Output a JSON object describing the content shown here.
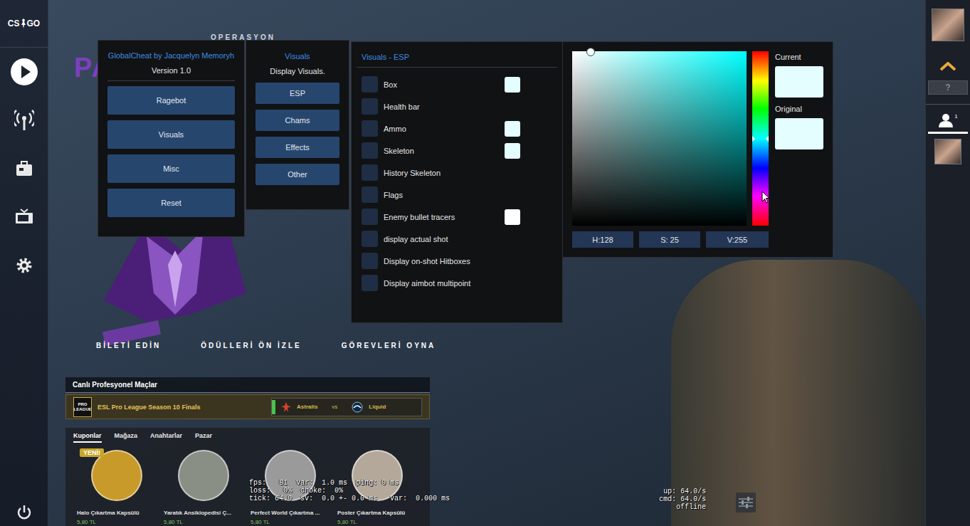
{
  "game": {
    "logo": {
      "left": "CS",
      "right": "GO"
    },
    "operation": {
      "title": "OPERASYON",
      "logo_text": "PA"
    },
    "promo_links": [
      "BİLETİ EDİN",
      "ÖDÜLLERİ ÖN İZLE",
      "GÖREVLERİ OYNA"
    ],
    "live_matches": {
      "title": "Canlı Profesyonel Maçlar",
      "league_logo": [
        "PRO",
        "LEAGUE"
      ],
      "event": "ESL Pro League Season 10 Finals",
      "team1": "Astralis",
      "vs": "vs",
      "team2": "Liquid",
      "live": true
    },
    "store": {
      "tabs": [
        {
          "label": "Kuponlar",
          "selected": true
        },
        {
          "label": "Mağaza",
          "selected": false
        },
        {
          "label": "Anahtarlar",
          "selected": false
        },
        {
          "label": "Pazar",
          "selected": false
        }
      ],
      "items": [
        {
          "name": "Halo Çıkartma Kapsülü",
          "price": "5,80 TL",
          "badge": "YENİ!",
          "color": "#c89a2a"
        },
        {
          "name": "Yaratık Ansiklopedisi Ç...",
          "price": "5,80 TL",
          "color": "#8a8f86"
        },
        {
          "name": "Perfect World Çıkartma ...",
          "price": "5,80 TL",
          "color": "#9a9a9a"
        },
        {
          "name": "Poster Çıkartma Kapsülü",
          "price": "5,80 TL",
          "color": "#b3a89a"
        }
      ]
    },
    "net_graph": {
      "lines": [
        "fps:   81  var:  1.0 ms  ping: 0 ms",
        "loss:   0%  choke:  0%",
        "tick: 64.0  sv:  0.0 +- 0.0 ms   var:  0.000 ms"
      ],
      "side": [
        "up: 64.0/s",
        "cmd: 64.0/s",
        "offline"
      ]
    },
    "friends": {
      "help": "?",
      "online_count": "1"
    }
  },
  "cheat": {
    "menu": {
      "title": "GlobalCheat by Jacquelyn Memoryh",
      "version": "Version 1.0",
      "buttons": [
        "Ragebot",
        "Visuals",
        "Misc",
        "Reset"
      ]
    },
    "submenu": {
      "title": "Visuals",
      "subtitle": "Display Visuals.",
      "buttons": [
        "ESP",
        "Chams",
        "Effects",
        "Other"
      ]
    },
    "esp": {
      "title": "Visuals - ESP",
      "options": [
        {
          "label": "Box",
          "checked": false,
          "color": "#e4fdff"
        },
        {
          "label": "Health bar",
          "checked": false
        },
        {
          "label": "Ammo",
          "checked": false,
          "color": "#e4fdff"
        },
        {
          "label": "Skeleton",
          "checked": false,
          "color": "#e4fdff"
        },
        {
          "label": "History Skeleton",
          "checked": false
        },
        {
          "label": "Flags",
          "checked": false
        },
        {
          "label": "Enemy bullet tracers",
          "checked": false,
          "color": "#ffffff"
        },
        {
          "label": "display actual shot",
          "checked": false
        },
        {
          "label": "Display on-shot Hitboxes",
          "checked": false
        },
        {
          "label": "Display aimbot multipoint",
          "checked": false
        }
      ]
    },
    "color_picker": {
      "hue": "H:128",
      "saturation": "S: 25",
      "value": "V:255",
      "hue_level": 0.5,
      "saturation_level": 0.1,
      "value_level": 1,
      "current_label": "Current",
      "original_label": "Original",
      "current_color": "#e4fdff",
      "original_color": "#e4fdff"
    }
  }
}
